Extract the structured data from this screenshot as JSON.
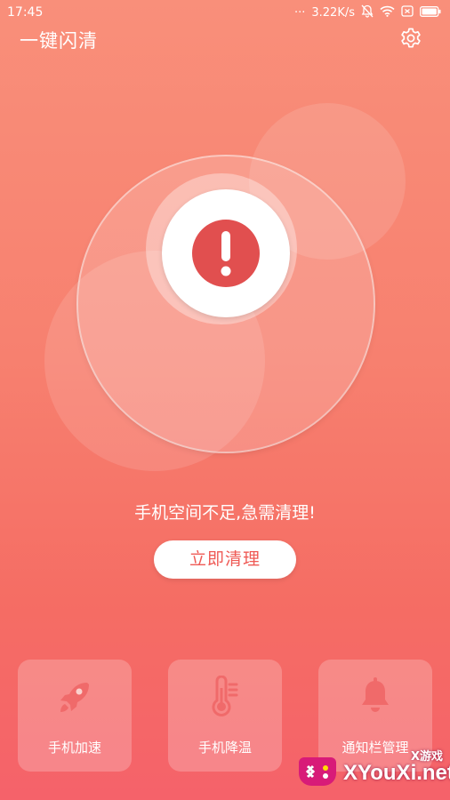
{
  "status_bar": {
    "time": "17:45",
    "dots": "···",
    "net_speed": "3.22K/s",
    "icons": [
      "mute-bell-icon",
      "wifi-icon",
      "sim-icon",
      "battery-icon"
    ]
  },
  "header": {
    "title": "一键闪清",
    "settings_icon": "gear-icon"
  },
  "main": {
    "alert_icon": "exclamation-icon",
    "message": "手机空间不足,急需清理!",
    "clean_button": "立即清理"
  },
  "cards": [
    {
      "label": "手机加速",
      "icon": "rocket-icon"
    },
    {
      "label": "手机降温",
      "icon": "thermometer-icon"
    },
    {
      "label": "通知栏管理",
      "icon": "bell-icon"
    }
  ],
  "watermark": {
    "text": "XYouXi.net",
    "top_text": "X游戏"
  },
  "colors": {
    "accent": "#ef5a55",
    "alert_red": "#e14f4f",
    "bg_top": "#f98f7a",
    "bg_bottom": "#f5626a"
  }
}
